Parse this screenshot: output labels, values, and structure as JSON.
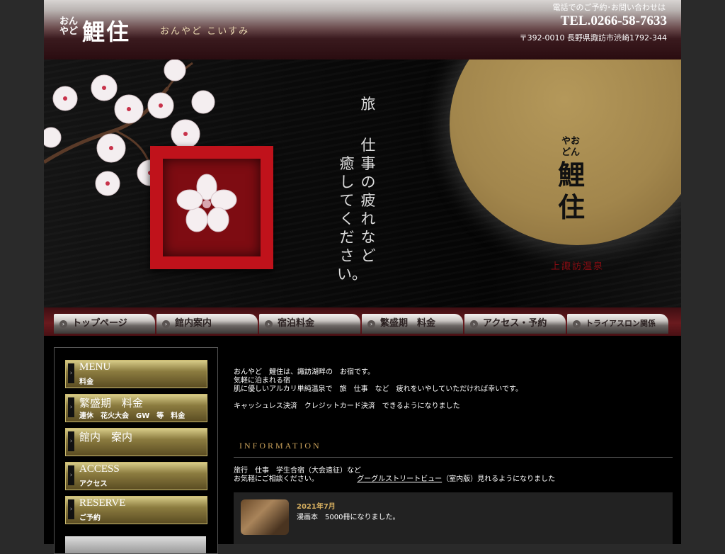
{
  "header": {
    "logo_small": "おん やど",
    "logo_big": "鯉住",
    "logo_reading": "おんやど こいすみ",
    "contact_note": "電話でのご予約･お問い合わせは",
    "tel": "TEL.0266-58-7633",
    "address": "〒392-0010 長野県諏訪市渋崎1792-344"
  },
  "hero": {
    "catch_col1": "旅",
    "catch_col2": "仕事の疲れなど",
    "catch_col3": "癒してください。",
    "moon_ruby": "やお どん",
    "moon_name": "鯉住",
    "moon_onsen": "上諏訪温泉"
  },
  "nav": {
    "items": [
      {
        "label": "トップページ"
      },
      {
        "label": "館内案内"
      },
      {
        "label": "宿泊料金"
      },
      {
        "label": "繁盛期　料金"
      },
      {
        "label": "アクセス・予約"
      },
      {
        "label": "トライアスロン関係"
      }
    ]
  },
  "sidebar": {
    "buttons": [
      {
        "big": "MENU",
        "small": "料金"
      },
      {
        "big": "繁盛期　料金",
        "small": "連休　花火大会　GW　等　料金"
      },
      {
        "big": "館内　案内",
        "small": ""
      },
      {
        "big": "ACCESS",
        "small": "アクセス"
      },
      {
        "big": "RESERVE",
        "small": "ご予約"
      }
    ]
  },
  "main": {
    "intro1": "おんやど　鯉住は、諏訪湖畔の　お宿です。",
    "intro2": "気軽に泊まれる宿",
    "intro3": "肌に優しいアルカリ単純温泉で　旅　仕事　など　疲れをいやしていただければ幸いです。",
    "intro4": "キャッシュレス決済　クレジットカード決済　できるようになりました"
  },
  "information": {
    "title": "INFORMATION",
    "line1": "旅行　仕事　学生合宿（大会遠征）など",
    "line2": "お気軽にご相談ください。",
    "link": "グーグルストリートビュー",
    "line2_suffix": "（室内版）見れるようになりました"
  },
  "news": {
    "date": "2021年7月",
    "text": "漫画本　5000冊になりました。"
  }
}
